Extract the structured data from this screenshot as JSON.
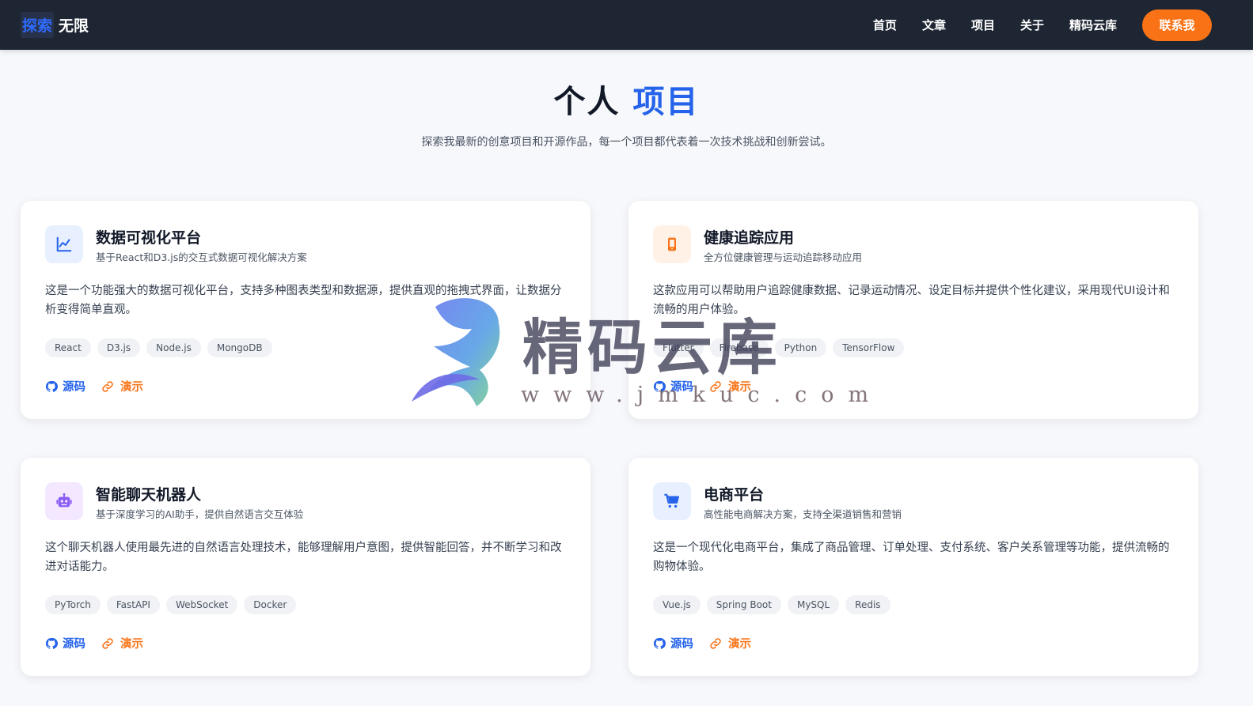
{
  "nav": {
    "logo_a": "探索",
    "logo_b": "无限",
    "links": [
      "首页",
      "文章",
      "项目",
      "关于",
      "精码云库"
    ],
    "contact_label": "联系我"
  },
  "hero": {
    "title_plain": "个人",
    "title_accent": "项目",
    "subtitle": "探索我最新的创意项目和开源作品，每一个项目都代表着一次技术挑战和创新尝试。"
  },
  "projects": [
    {
      "icon": "chart-line-icon",
      "title": "数据可视化平台",
      "subtitle": "基于React和D3.js的交互式数据可视化解决方案",
      "description": "这是一个功能强大的数据可视化平台，支持多种图表类型和数据源，提供直观的拖拽式界面，让数据分析变得简单直观。",
      "tags": [
        "React",
        "D3.js",
        "Node.js",
        "MongoDB"
      ],
      "source_label": "源码",
      "demo_label": "演示"
    },
    {
      "icon": "mobile-phone-icon",
      "title": "健康追踪应用",
      "subtitle": "全方位健康管理与运动追踪移动应用",
      "description": "这款应用可以帮助用户追踪健康数据、记录运动情况、设定目标并提供个性化建议，采用现代UI设计和流畅的用户体验。",
      "tags": [
        "Flutter",
        "Firebase",
        "Python",
        "TensorFlow"
      ],
      "source_label": "源码",
      "demo_label": "演示"
    },
    {
      "icon": "robot-icon",
      "title": "智能聊天机器人",
      "subtitle": "基于深度学习的AI助手，提供自然语言交互体验",
      "description": "这个聊天机器人使用最先进的自然语言处理技术，能够理解用户意图，提供智能回答，并不断学习和改进对话能力。",
      "tags": [
        "PyTorch",
        "FastAPI",
        "WebSocket",
        "Docker"
      ],
      "source_label": "源码",
      "demo_label": "演示"
    },
    {
      "icon": "shopping-cart-icon",
      "title": "电商平台",
      "subtitle": "高性能电商解决方案，支持全渠道销售和营销",
      "description": "这是一个现代化电商平台，集成了商品管理、订单处理、支付系统、客户关系管理等功能，提供流畅的购物体验。",
      "tags": [
        "Vue.js",
        "Spring Boot",
        "MySQL",
        "Redis"
      ],
      "source_label": "源码",
      "demo_label": "演示"
    }
  ],
  "watermark": {
    "text": "精码云库",
    "url": "www.jmkuc.com"
  },
  "colors": {
    "nav_bg": "#1e2633",
    "accent_blue": "#2563eb",
    "accent_orange": "#f97316"
  }
}
